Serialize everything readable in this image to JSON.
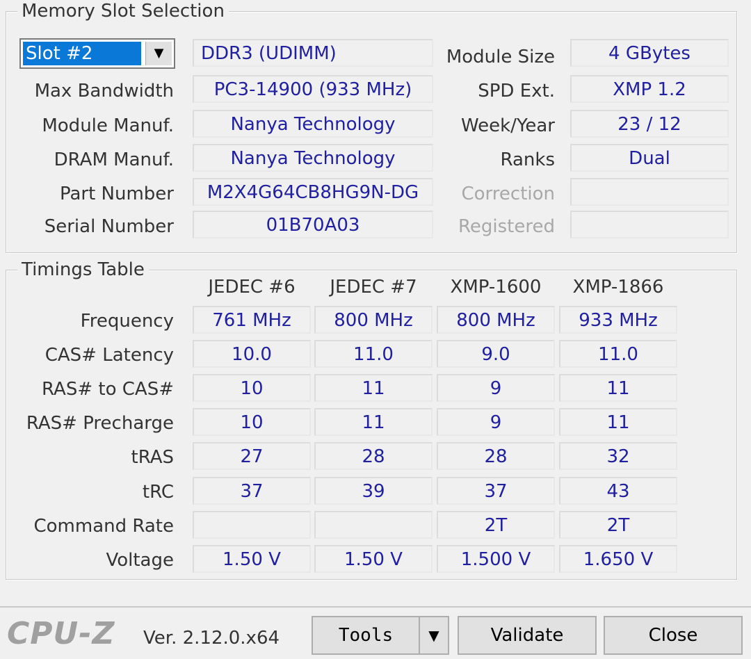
{
  "slot_group": {
    "title": "Memory Slot Selection",
    "slot_selected": "Slot #2",
    "memory_type": "DDR3 (UDIMM)",
    "rows": [
      {
        "label": "Max Bandwidth",
        "value": "PC3-14900 (933 MHz)"
      },
      {
        "label": "Module Manuf.",
        "value": "Nanya Technology"
      },
      {
        "label": "DRAM Manuf.",
        "value": "Nanya Technology"
      },
      {
        "label": "Part Number",
        "value": "M2X4G64CB8HG9N-DG"
      },
      {
        "label": "Serial Number",
        "value": "01B70A03"
      }
    ],
    "right_rows": [
      {
        "label": "Module Size",
        "value": "4 GBytes",
        "enabled": true
      },
      {
        "label": "SPD Ext.",
        "value": "XMP 1.2",
        "enabled": true
      },
      {
        "label": "Week/Year",
        "value": "23 / 12",
        "enabled": true
      },
      {
        "label": "Ranks",
        "value": "Dual",
        "enabled": true
      },
      {
        "label": "Correction",
        "value": "",
        "enabled": false
      },
      {
        "label": "Registered",
        "value": "",
        "enabled": false
      }
    ]
  },
  "timings": {
    "title": "Timings Table",
    "columns": [
      "JEDEC #6",
      "JEDEC #7",
      "XMP-1600",
      "XMP-1866"
    ],
    "rows": [
      {
        "label": "Frequency",
        "values": [
          "761 MHz",
          "800 MHz",
          "800 MHz",
          "933 MHz"
        ]
      },
      {
        "label": "CAS# Latency",
        "values": [
          "10.0",
          "11.0",
          "9.0",
          "11.0"
        ]
      },
      {
        "label": "RAS# to CAS#",
        "values": [
          "10",
          "11",
          "9",
          "11"
        ]
      },
      {
        "label": "RAS# Precharge",
        "values": [
          "10",
          "11",
          "9",
          "11"
        ]
      },
      {
        "label": "tRAS",
        "values": [
          "27",
          "28",
          "28",
          "32"
        ]
      },
      {
        "label": "tRC",
        "values": [
          "37",
          "39",
          "37",
          "43"
        ]
      },
      {
        "label": "Command Rate",
        "values": [
          "",
          "",
          "2T",
          "2T"
        ]
      },
      {
        "label": "Voltage",
        "values": [
          "1.50 V",
          "1.50 V",
          "1.500 V",
          "1.650 V"
        ]
      }
    ]
  },
  "footer": {
    "brand": "CPU-Z",
    "version": "Ver. 2.12.0.x64",
    "tools_label": "Tools",
    "validate_label": "Validate",
    "close_label": "Close"
  }
}
